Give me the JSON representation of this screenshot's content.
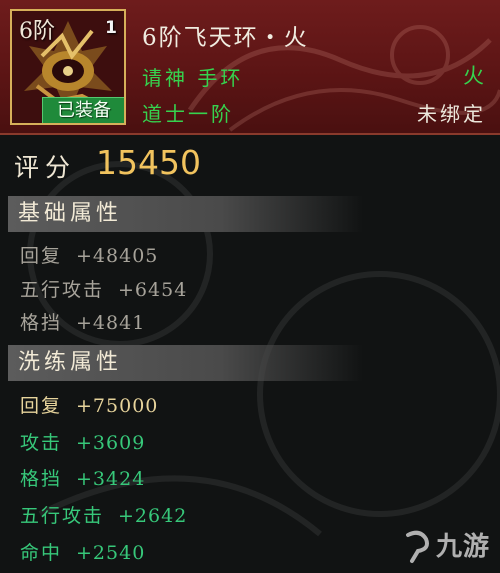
{
  "header": {
    "item_tier_label": "6阶",
    "item_count": "1",
    "equipped_badge": "已装备",
    "item_name": "6阶飞天环・火",
    "item_type": "请神  手环",
    "element": "火",
    "class_requirement": "道士一阶",
    "bind_status": "未绑定"
  },
  "score": {
    "label": "评分",
    "value": "15450"
  },
  "base_attributes": {
    "title": "基础属性",
    "items": [
      {
        "name": "回复",
        "value": "+48405"
      },
      {
        "name": "五行攻击",
        "value": "+6454"
      },
      {
        "name": "格挡",
        "value": "+4841"
      }
    ]
  },
  "refine_attributes": {
    "title": "洗练属性",
    "items": [
      {
        "name": "回复",
        "value": "+75000",
        "color": "#e7d49c"
      },
      {
        "name": "攻击",
        "value": "+3609",
        "color": "#37c87a"
      },
      {
        "name": "格挡",
        "value": "+3424",
        "color": "#37c87a"
      },
      {
        "name": "五行攻击",
        "value": "+2642",
        "color": "#37c87a"
      },
      {
        "name": "命中",
        "value": "+2540",
        "color": "#37c87a"
      }
    ]
  },
  "watermark": {
    "text": "九游"
  },
  "colors": {
    "header_bg": "#5a1414",
    "green_text": "#36d24e",
    "score_gold": "#f1c35e",
    "base_attr_gray": "#a7a39a",
    "refine_gold": "#e7d49c",
    "refine_green": "#37c87a"
  }
}
